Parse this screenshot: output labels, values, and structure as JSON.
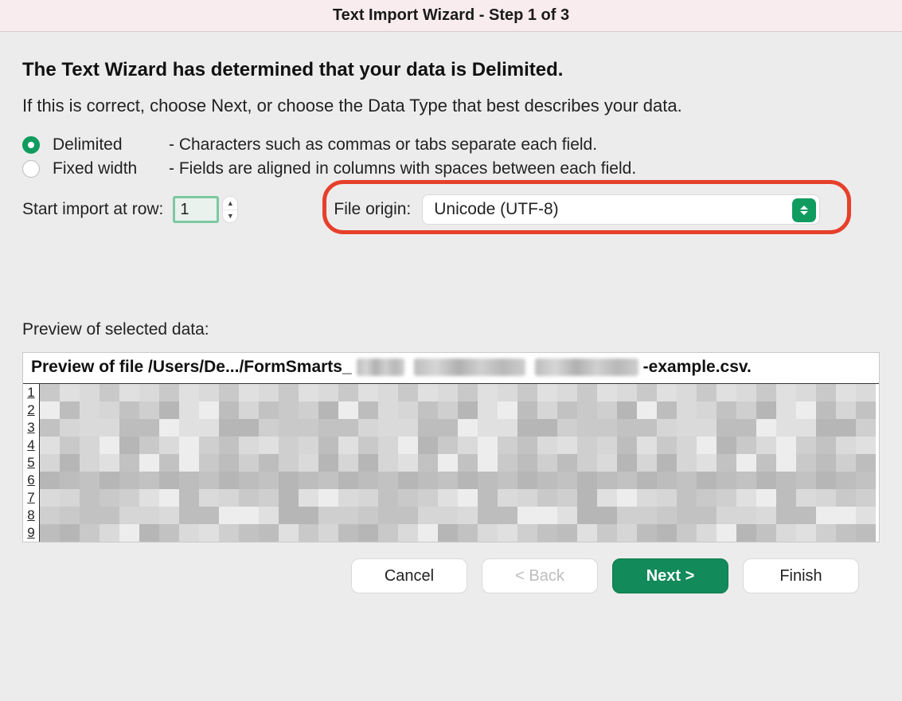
{
  "titlebar": {
    "title": "Text Import Wizard - Step 1 of 3"
  },
  "heading": "The Text Wizard has determined that your data is Delimited.",
  "subtext": "If this is correct, choose Next, or choose the Data Type that best describes your data.",
  "options": {
    "delimited": {
      "label": "Delimited",
      "desc": "- Characters such as commas or tabs separate each field.",
      "selected": true
    },
    "fixed": {
      "label": "Fixed width",
      "desc": "- Fields are aligned in columns with spaces between each field.",
      "selected": false
    }
  },
  "start_row": {
    "label": "Start import at row:",
    "value": "1"
  },
  "file_origin": {
    "label": "File origin:",
    "value": "Unicode (UTF-8)"
  },
  "preview": {
    "label": "Preview of selected data:",
    "file_prefix": "Preview of file /Users/De.../FormSmarts_",
    "file_suffix": "-example.csv.",
    "line_numbers": [
      "1",
      "2",
      "3",
      "4",
      "5",
      "6",
      "7",
      "8",
      "9"
    ]
  },
  "buttons": {
    "cancel": "Cancel",
    "back": "< Back",
    "next": "Next >",
    "finish": "Finish"
  }
}
